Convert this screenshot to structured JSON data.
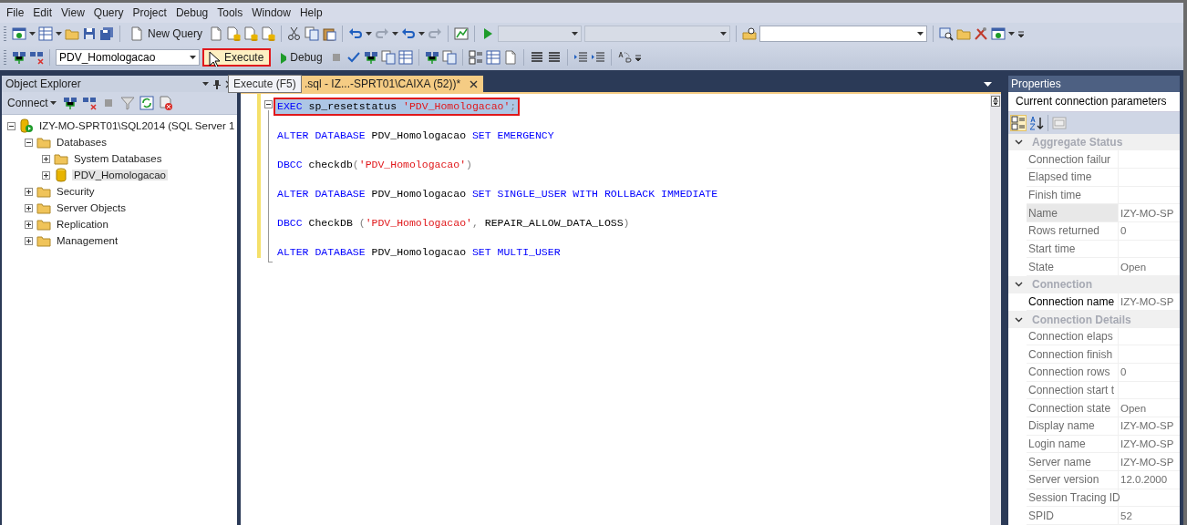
{
  "menu_bar": {
    "items": [
      "File",
      "Edit",
      "View",
      "Query",
      "Project",
      "Debug",
      "Tools",
      "Window",
      "Help"
    ]
  },
  "toolbar_1": {
    "new_query": "New Query",
    "combo_1": {
      "disabled": true
    },
    "combo_2": {
      "disabled": true
    },
    "find_combo": {
      "disabled": false
    }
  },
  "toolbar_2": {
    "database": "PDV_Homologacao",
    "execute": {
      "label": "Execute",
      "highlighted": true
    },
    "debug": "Debug",
    "tooltip": "Execute (F5)"
  },
  "object_explorer": {
    "title": "Object Explorer",
    "connect": "Connect",
    "tree": [
      {
        "label": "IZY-MO-SPRT01\\SQL2014 (SQL Server 1",
        "kind": "server",
        "expanded": true,
        "selected": false,
        "children": [
          {
            "label": "Databases",
            "kind": "folder",
            "expanded": true,
            "selected": false,
            "children": [
              {
                "label": "System Databases",
                "kind": "folder",
                "expanded": false,
                "selected": false
              },
              {
                "label": "PDV_Homologacao",
                "kind": "database",
                "expanded": false,
                "selected": true
              }
            ]
          },
          {
            "label": "Security",
            "kind": "folder",
            "expanded": false,
            "selected": false
          },
          {
            "label": "Server Objects",
            "kind": "folder",
            "expanded": false,
            "selected": false
          },
          {
            "label": "Replication",
            "kind": "folder",
            "expanded": false,
            "selected": false
          },
          {
            "label": "Management",
            "kind": "folder",
            "expanded": false,
            "selected": false
          }
        ]
      }
    ]
  },
  "editor": {
    "tab": {
      "title": ".sql - IZ...-SPRT01\\CAIXA (52))*",
      "selected": true
    },
    "lines": [
      {
        "selected": true,
        "highlighted": true,
        "tokens": [
          {
            "text": "EXEC",
            "kind": "keyword"
          },
          {
            "text": " sp_resetstatus ",
            "kind": "plain"
          },
          {
            "text": "'PDV_Homologacao'",
            "kind": "string"
          },
          {
            "text": ";",
            "kind": "operator"
          }
        ]
      },
      {
        "selected": false,
        "highlighted": false,
        "tokens": [
          {
            "text": "ALTER DATABASE",
            "kind": "keyword"
          },
          {
            "text": " PDV_Homologacao ",
            "kind": "plain"
          },
          {
            "text": "SET EMERGENCY",
            "kind": "keyword"
          }
        ]
      },
      {
        "selected": false,
        "highlighted": false,
        "tokens": [
          {
            "text": "DBCC",
            "kind": "keyword"
          },
          {
            "text": " checkdb",
            "kind": "plain"
          },
          {
            "text": "(",
            "kind": "operator"
          },
          {
            "text": "'PDV_Homologacao'",
            "kind": "string"
          },
          {
            "text": ")",
            "kind": "operator"
          }
        ]
      },
      {
        "selected": false,
        "highlighted": false,
        "tokens": [
          {
            "text": "ALTER DATABASE",
            "kind": "keyword"
          },
          {
            "text": " PDV_Homologacao ",
            "kind": "plain"
          },
          {
            "text": "SET SINGLE_USER WITH ROLLBACK IMMEDIATE",
            "kind": "keyword"
          }
        ]
      },
      {
        "selected": false,
        "highlighted": false,
        "tokens": [
          {
            "text": "DBCC",
            "kind": "keyword"
          },
          {
            "text": " CheckDB ",
            "kind": "plain"
          },
          {
            "text": "(",
            "kind": "operator"
          },
          {
            "text": "'PDV_Homologacao'",
            "kind": "string"
          },
          {
            "text": ",",
            "kind": "operator"
          },
          {
            "text": " REPAIR_ALLOW_DATA_LOSS",
            "kind": "plain"
          },
          {
            "text": ")",
            "kind": "operator"
          }
        ]
      },
      {
        "selected": false,
        "highlighted": false,
        "tokens": [
          {
            "text": "ALTER DATABASE",
            "kind": "keyword"
          },
          {
            "text": " PDV_Homologacao ",
            "kind": "plain"
          },
          {
            "text": "SET MULTI_USER",
            "kind": "keyword"
          }
        ]
      }
    ]
  },
  "properties": {
    "title": "Properties",
    "object": "Current connection parameters",
    "categorized_selected": true,
    "categories": [
      {
        "name": "Aggregate Status",
        "expanded": true,
        "rows": [
          {
            "name": "Connection failur",
            "value": "",
            "selected": false,
            "readonly": true
          },
          {
            "name": "Elapsed time",
            "value": "",
            "selected": false,
            "readonly": true
          },
          {
            "name": "Finish time",
            "value": "",
            "selected": false,
            "readonly": true
          },
          {
            "name": "Name",
            "value": "IZY-MO-SP",
            "selected": true,
            "readonly": true
          },
          {
            "name": "Rows returned",
            "value": "0",
            "selected": false,
            "readonly": true
          },
          {
            "name": "Start time",
            "value": "",
            "selected": false,
            "readonly": true
          },
          {
            "name": "State",
            "value": "Open",
            "selected": false,
            "readonly": true
          }
        ]
      },
      {
        "name": "Connection",
        "expanded": true,
        "rows": [
          {
            "name": "Connection name",
            "value": "IZY-MO-SP",
            "selected": false,
            "readonly": false
          }
        ]
      },
      {
        "name": "Connection Details",
        "expanded": true,
        "rows": [
          {
            "name": "Connection elaps",
            "value": "",
            "selected": false,
            "readonly": true
          },
          {
            "name": "Connection finish",
            "value": "",
            "selected": false,
            "readonly": true
          },
          {
            "name": "Connection rows",
            "value": "0",
            "selected": false,
            "readonly": true
          },
          {
            "name": "Connection start t",
            "value": "",
            "selected": false,
            "readonly": true
          },
          {
            "name": "Connection state",
            "value": "Open",
            "selected": false,
            "readonly": true
          },
          {
            "name": "Display name",
            "value": "IZY-MO-SP",
            "selected": false,
            "readonly": true
          },
          {
            "name": "Login name",
            "value": "IZY-MO-SP",
            "selected": false,
            "readonly": true
          },
          {
            "name": "Server name",
            "value": "IZY-MO-SP",
            "selected": false,
            "readonly": true
          },
          {
            "name": "Server version",
            "value": "12.0.2000",
            "selected": false,
            "readonly": true
          },
          {
            "name": "Session Tracing ID",
            "value": "",
            "selected": false,
            "readonly": true
          },
          {
            "name": "SPID",
            "value": "52",
            "selected": false,
            "readonly": true
          }
        ]
      }
    ]
  }
}
